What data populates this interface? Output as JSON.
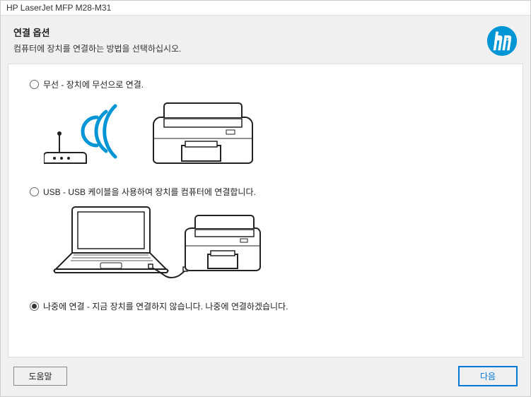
{
  "window": {
    "title": "HP LaserJet MFP M28-M31"
  },
  "header": {
    "title": "연결 옵션",
    "subtitle": "컴퓨터에 장치를 연결하는 방법을 선택하십시오."
  },
  "options": {
    "wireless": {
      "label": "무선 - 장치에 무선으로 연결.",
      "selected": false
    },
    "usb": {
      "label": "USB - USB 케이블을 사용하여 장치를 컴퓨터에 연결합니다.",
      "selected": false
    },
    "later": {
      "label": "나중에 연결 - 지금 장치를 연결하지 않습니다. 나중에 연결하겠습니다.",
      "selected": true
    }
  },
  "footer": {
    "help": "도움말",
    "next": "다음"
  }
}
